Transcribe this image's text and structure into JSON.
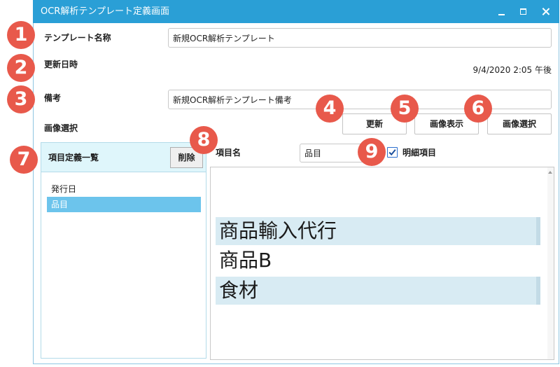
{
  "window": {
    "title": "OCR解析テンプレート定義画面",
    "controls": {
      "minimize": "minimize-icon",
      "maximize": "maximize-icon",
      "close": "close-icon"
    }
  },
  "form": {
    "template_name": {
      "label": "テンプレート名称",
      "value": "新規OCR解析テンプレート"
    },
    "updated_at": {
      "label": "更新日時",
      "value": "9/4/2020 2:05 午後"
    },
    "remarks": {
      "label": "備考",
      "value": "新規OCR解析テンプレート備考"
    },
    "image_select": {
      "label": "画像選択"
    }
  },
  "actions": {
    "update_label": "更新",
    "show_image_label": "画像表示",
    "select_image_label": "画像選択"
  },
  "item_list": {
    "title": "項目定義一覧",
    "delete_label": "削除",
    "items": [
      {
        "label": "発行日",
        "selected": false
      },
      {
        "label": "品目",
        "selected": true
      }
    ]
  },
  "item_detail": {
    "name_label": "項目名",
    "name_value": "品目",
    "detail_item": {
      "label": "明細項目",
      "checked": true
    }
  },
  "preview": {
    "rows": [
      {
        "text": "商品輸入代行",
        "highlighted": true
      },
      {
        "text": "商品B",
        "highlighted": false
      },
      {
        "text": "食材",
        "highlighted": true
      }
    ]
  },
  "annotations": {
    "badges": [
      "1",
      "2",
      "3",
      "4",
      "5",
      "6",
      "7",
      "8",
      "9"
    ]
  },
  "colors": {
    "title_bar": "#2A9FD6",
    "badge": "#E8594B",
    "selection": "#6CC4EC",
    "list_header": "#DFF6FB",
    "preview_highlight": "#D8EBF3"
  }
}
